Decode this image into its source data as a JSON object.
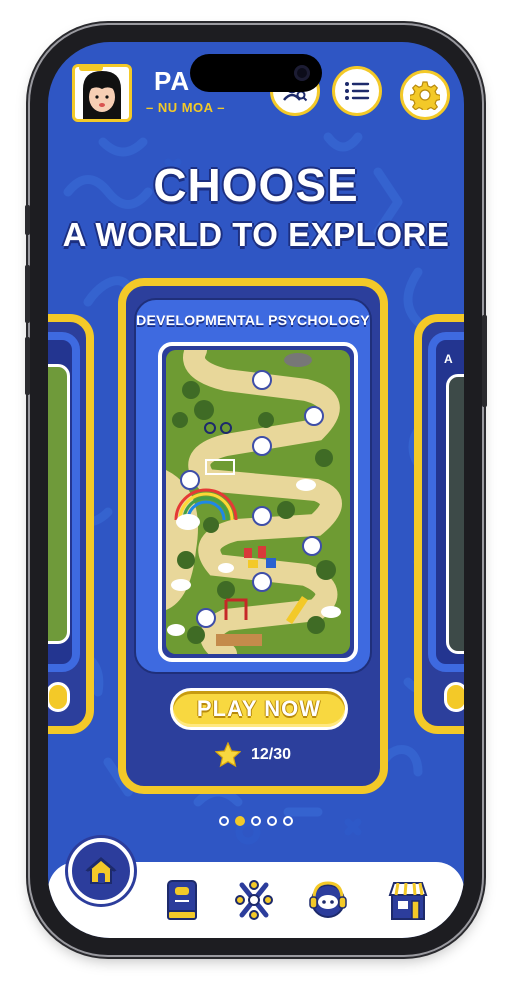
{
  "user": {
    "name": "PA",
    "level_label": "NU MOA",
    "avatar": "girl-avatar"
  },
  "header": {
    "buttons": [
      {
        "name": "search-user",
        "icon": "user-search-icon"
      },
      {
        "name": "menu",
        "icon": "list-icon"
      },
      {
        "name": "settings",
        "icon": "gear-icon"
      }
    ]
  },
  "heading": {
    "line1": "CHOOSE",
    "line2": "A WORLD TO EXPLORE"
  },
  "carousel": {
    "active_index": 1,
    "dot_count": 5,
    "worlds": [
      {
        "title": "",
        "position": "previous"
      },
      {
        "title": "DEVELOPMENTAL PSYCHOLOGY",
        "play_label": "PLAY NOW",
        "progress_text": "12/30",
        "progress_icon": "star-icon",
        "position": "current"
      },
      {
        "title": "A",
        "position": "next"
      }
    ]
  },
  "bottom_nav": {
    "items": [
      {
        "name": "home",
        "icon": "home-icon",
        "active": true
      },
      {
        "name": "notebook",
        "icon": "notebook-icon"
      },
      {
        "name": "network",
        "icon": "network-icon"
      },
      {
        "name": "support",
        "icon": "headset-icon"
      },
      {
        "name": "shop",
        "icon": "shop-icon"
      }
    ]
  },
  "colors": {
    "background": "#2f56c4",
    "accent": "#f3c928",
    "card": "#2c3f9c",
    "card_inner": "#3e6ae0"
  }
}
